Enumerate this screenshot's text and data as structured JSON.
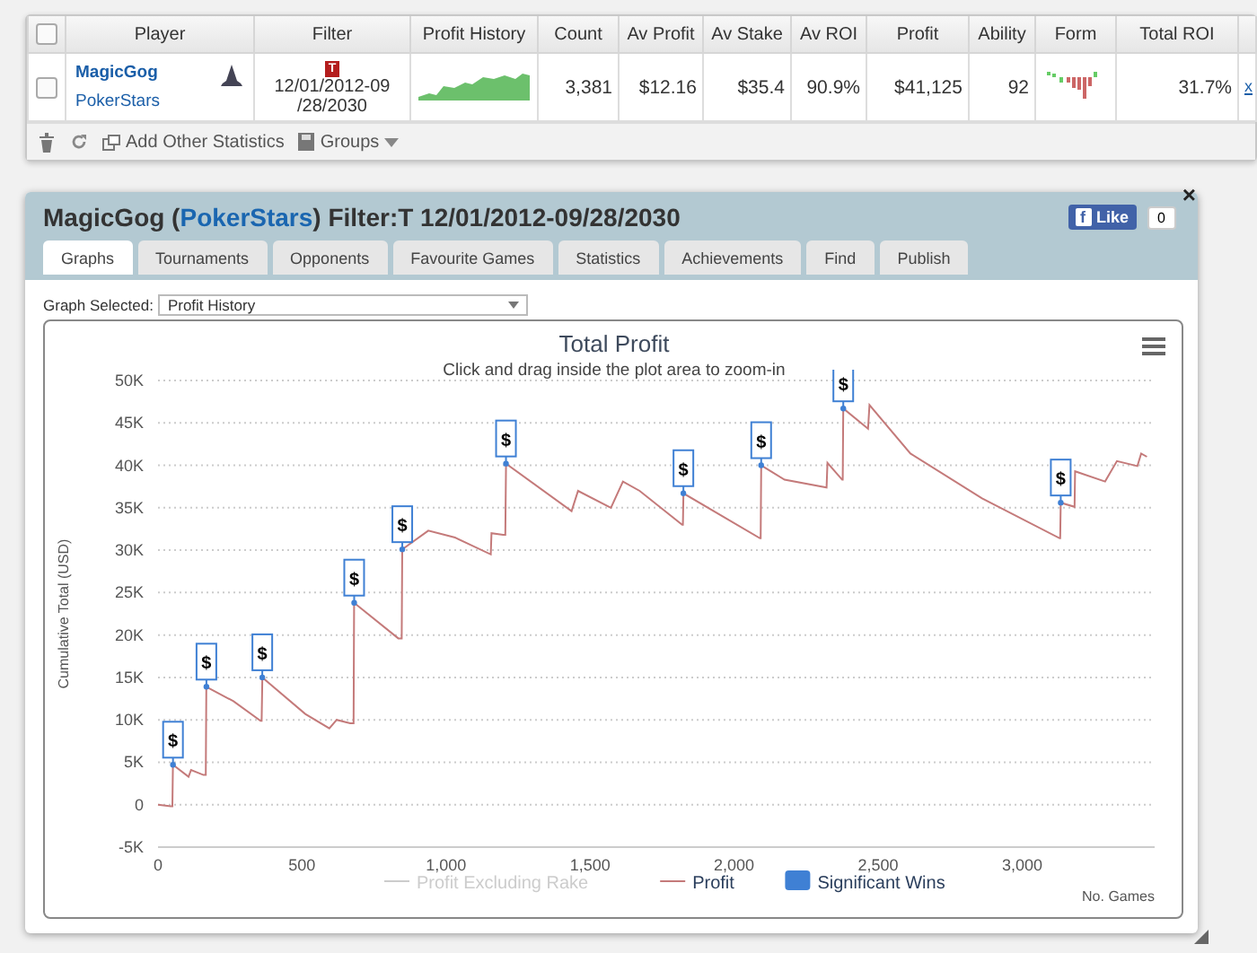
{
  "stats_table": {
    "select_all_checked": false,
    "columns": [
      "Player",
      "Filter",
      "Profit History",
      "Count",
      "Av Profit",
      "Av Stake",
      "Av ROI",
      "Profit",
      "Ability",
      "Form",
      "Total ROI"
    ],
    "rows": [
      {
        "checked": false,
        "player": "MagicGog",
        "site": "PokerStars",
        "filter_badge": "T",
        "filter_lines": [
          "12/01/2012-09",
          "/28/2030"
        ],
        "count": "3,381",
        "av_profit": "$12.16",
        "av_stake": "$35.4",
        "av_roi": "90.9%",
        "profit": "$41,125",
        "ability": "92",
        "total_roi": "31.7%",
        "remove": "x"
      }
    ],
    "toolbar": {
      "add_label": "Add Other Statistics",
      "groups_label": "Groups"
    }
  },
  "panel": {
    "title_prefix": "MagicGog (",
    "title_link": "PokerStars",
    "title_suffix": ") Filter:T 12/01/2012-09/28/2030",
    "close": "×",
    "like": {
      "icon": "f",
      "label": "Like",
      "count": "0"
    },
    "tabs": [
      {
        "label": "Graphs",
        "selected": true
      },
      {
        "label": "Tournaments",
        "selected": false
      },
      {
        "label": "Opponents",
        "selected": false
      },
      {
        "label": "Favourite Games",
        "selected": false
      },
      {
        "label": "Statistics",
        "selected": false
      },
      {
        "label": "Achievements",
        "selected": false
      },
      {
        "label": "Find",
        "selected": false
      },
      {
        "label": "Publish",
        "selected": false
      }
    ],
    "graph_select": {
      "label": "Graph Selected:",
      "value": "Profit History"
    },
    "chart_subtitle": "Click and drag inside the plot area to zoom-in",
    "hidden_series": [
      {
        "label": "Profit Excluding Rake",
        "enabled": false
      }
    ],
    "flag_label": "$",
    "chart_data": {
      "type": "line",
      "grid": true,
      "legend": "bottom",
      "title": "Total Profit",
      "xlabel": "No. Games",
      "ylabel": "Cumulative Total (USD)",
      "xlim": [
        0,
        3460
      ],
      "ylim": [
        -5000,
        50000
      ],
      "xticks": [
        {
          "value": 0,
          "label": "0"
        },
        {
          "value": 500,
          "label": "500"
        },
        {
          "value": 1000,
          "label": "1,000"
        },
        {
          "value": 1500,
          "label": "1,500"
        },
        {
          "value": 2000,
          "label": "2,000"
        },
        {
          "value": 2500,
          "label": "2,500"
        },
        {
          "value": 3000,
          "label": "3,000"
        }
      ],
      "yticks": [
        {
          "value": -5000,
          "label": "-5K"
        },
        {
          "value": 0,
          "label": "0"
        },
        {
          "value": 5000,
          "label": "5K"
        },
        {
          "value": 10000,
          "label": "10K"
        },
        {
          "value": 15000,
          "label": "15K"
        },
        {
          "value": 20000,
          "label": "20K"
        },
        {
          "value": 25000,
          "label": "25K"
        },
        {
          "value": 30000,
          "label": "30K"
        },
        {
          "value": 35000,
          "label": "35K"
        },
        {
          "value": 40000,
          "label": "40K"
        },
        {
          "value": 45000,
          "label": "45K"
        },
        {
          "value": 50000,
          "label": "50K"
        }
      ],
      "x": [
        0,
        44,
        50,
        52,
        106,
        115,
        158,
        166,
        168,
        262,
        356,
        360,
        362,
        511,
        595,
        620,
        667,
        679,
        681,
        834,
        846,
        848,
        938,
        1031,
        1155,
        1158,
        1198,
        1206,
        1208,
        1436,
        1458,
        1572,
        1614,
        1672,
        1820,
        1822,
        1824,
        2090,
        2092,
        2094,
        2175,
        2321,
        2324,
        2375,
        2377,
        2379,
        2465,
        2470,
        2612,
        2861,
        3130,
        3132,
        3134,
        3182,
        3184,
        3288,
        3329,
        3400,
        3413,
        3433
      ],
      "series": [
        {
          "name": "Profit",
          "color": "#c47a7a",
          "values": [
            0,
            -200,
            -200,
            4700,
            3300,
            4100,
            3500,
            3500,
            13900,
            12200,
            9900,
            9900,
            15000,
            10700,
            9000,
            10000,
            9600,
            9600,
            23800,
            19600,
            19600,
            30100,
            32300,
            31500,
            29500,
            32000,
            31800,
            31800,
            40200,
            34600,
            37000,
            35000,
            38100,
            37000,
            33000,
            33000,
            36700,
            31400,
            31400,
            40000,
            38300,
            37400,
            40300,
            38300,
            38300,
            46700,
            44300,
            47100,
            41400,
            36100,
            31400,
            31400,
            35600,
            35100,
            39300,
            38100,
            40500,
            39900,
            41400,
            41000
          ]
        },
        {
          "name": "Significant Wins",
          "color": "#3f80d4",
          "marker": "circle",
          "values": [
            null,
            null,
            null,
            4700,
            null,
            null,
            null,
            null,
            13900,
            null,
            null,
            null,
            15000,
            null,
            null,
            null,
            null,
            null,
            23800,
            null,
            null,
            30100,
            null,
            null,
            null,
            null,
            null,
            null,
            40200,
            null,
            null,
            null,
            null,
            null,
            null,
            null,
            36700,
            null,
            null,
            40000,
            null,
            null,
            null,
            null,
            null,
            46700,
            null,
            null,
            null,
            null,
            null,
            null,
            35600,
            null,
            null,
            null,
            null,
            null,
            null,
            null
          ]
        }
      ]
    }
  }
}
